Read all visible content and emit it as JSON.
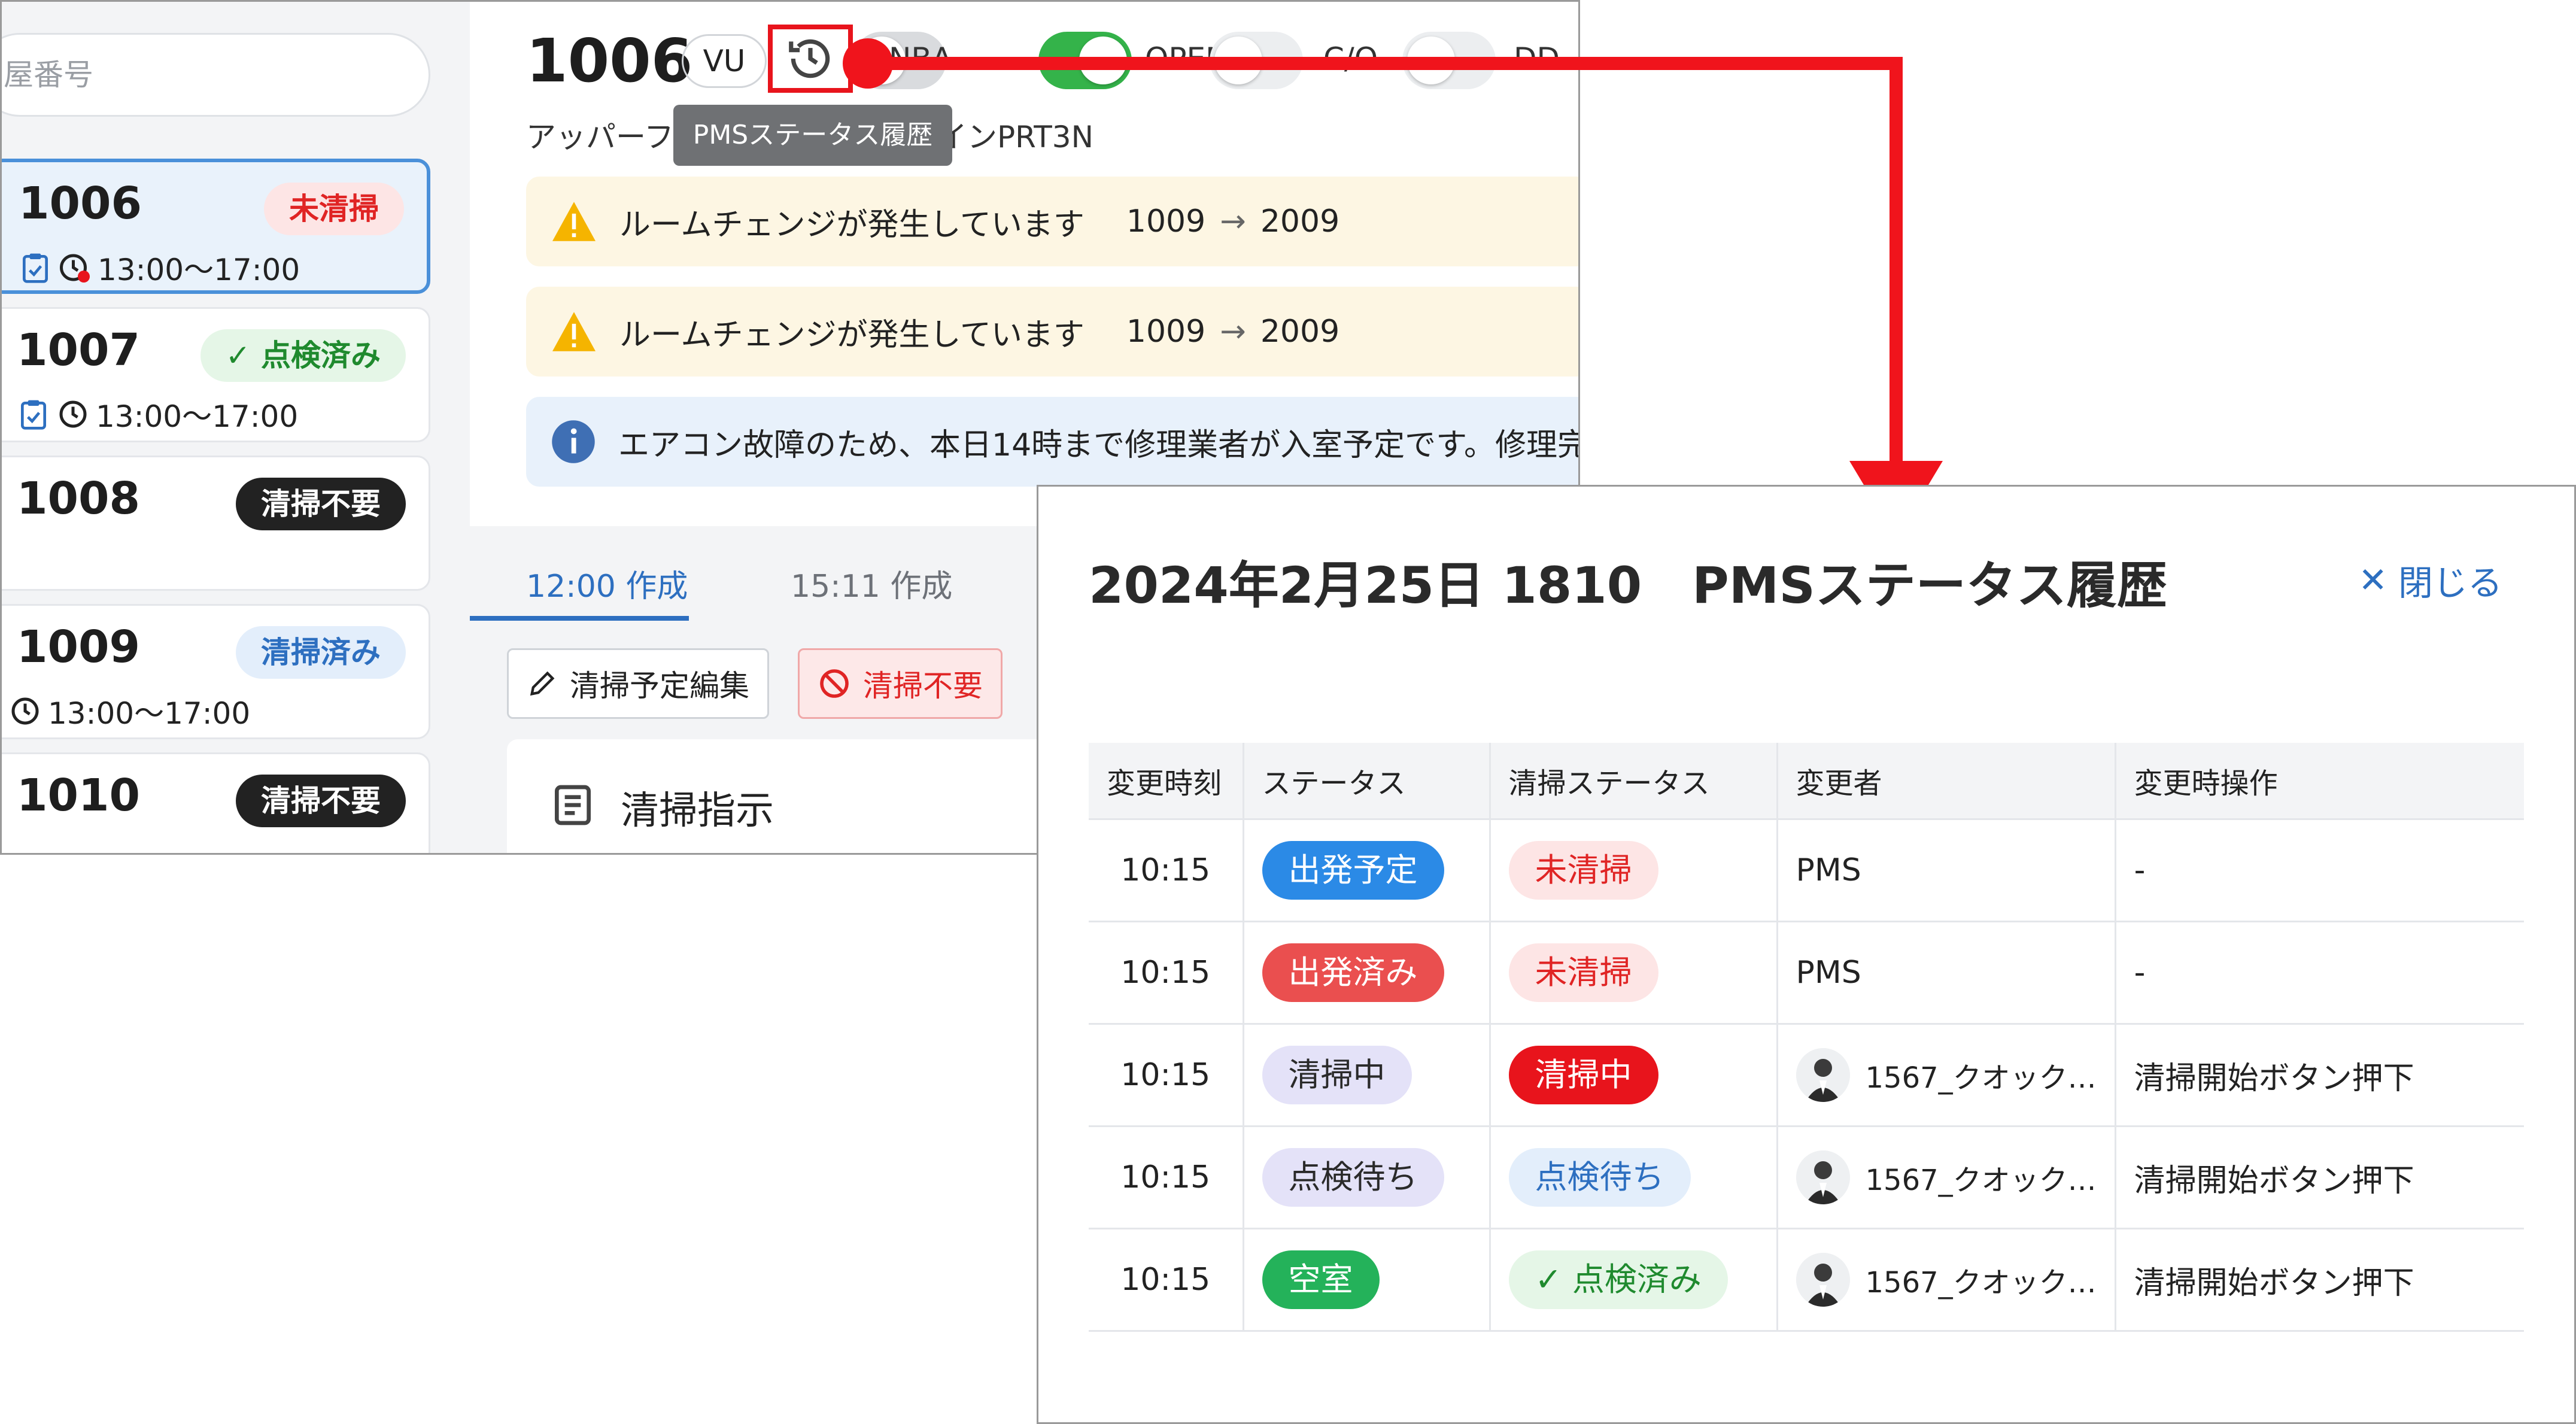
{
  "sidebar": {
    "search_placeholder": "屋番号",
    "rooms": [
      {
        "number": "1006",
        "badge": "未清掃",
        "time": "13:00〜17:00"
      },
      {
        "number": "1007",
        "badge": "点検済み",
        "time": "13:00〜17:00"
      },
      {
        "number": "1008",
        "badge": "清掃不要",
        "time": ""
      },
      {
        "number": "1009",
        "badge": "清掃済み",
        "time": "13:00〜17:00"
      },
      {
        "number": "1010",
        "badge": "清掃不要",
        "time": ""
      }
    ]
  },
  "room_header": {
    "number": "1006",
    "type_badge": "VU",
    "toggles": [
      {
        "label": "NBA",
        "on": false
      },
      {
        "label": "OPEN",
        "on": true
      },
      {
        "label": "C/O",
        "on": false
      },
      {
        "label": "DD",
        "on": false
      }
    ],
    "subtitle_left": "アッパーフ",
    "subtitle_right": "インPRT3N",
    "tooltip": "PMSステータス履歴"
  },
  "alerts": [
    {
      "kind": "warning",
      "text": "ルームチェンジが発生しています",
      "from": "1009",
      "arrow": "→",
      "to": "2009"
    },
    {
      "kind": "warning",
      "text": "ルームチェンジが発生しています",
      "from": "1009",
      "arrow": "→",
      "to": "2009"
    },
    {
      "kind": "info",
      "text": "エアコン故障のため、本日14時まで修理業者が入室予定です。修理完"
    }
  ],
  "tabs": [
    {
      "label": "12:00 作成",
      "active": true
    },
    {
      "label": "15:11 作成",
      "active": false
    }
  ],
  "actions": {
    "edit_label": "清掃予定編集",
    "no_clean_label": "清掃不要"
  },
  "instructions_title": "清掃指示",
  "modal": {
    "title": "2024年2月25日 1810　PMSステータス履歴",
    "close_label": "閉じる",
    "columns": [
      "変更時刻",
      "ステータス",
      "清掃ステータス",
      "変更者",
      "変更時操作"
    ],
    "rows": [
      {
        "time": "10:15",
        "status": "出発予定",
        "cleaning": "未清掃",
        "changer": "PMS",
        "operation": "-"
      },
      {
        "time": "10:15",
        "status": "出発済み",
        "cleaning": "未清掃",
        "changer": "PMS",
        "operation": "-"
      },
      {
        "time": "10:15",
        "status": "清掃中",
        "cleaning": "清掃中",
        "changer": "1567_クオック…",
        "operation": "清掃開始ボタン押下"
      },
      {
        "time": "10:15",
        "status": "点検待ち",
        "cleaning": "点検待ち",
        "changer": "1567_クオック…",
        "operation": "清掃開始ボタン押下"
      },
      {
        "time": "10:15",
        "status": "空室",
        "cleaning": "点検済み",
        "changer": "1567_クオック…",
        "operation": "清掃開始ボタン押下"
      }
    ]
  },
  "colors": {
    "accent": "#2d6fc0",
    "highlight": "#e8141c",
    "toggle_on": "#34b34a"
  }
}
